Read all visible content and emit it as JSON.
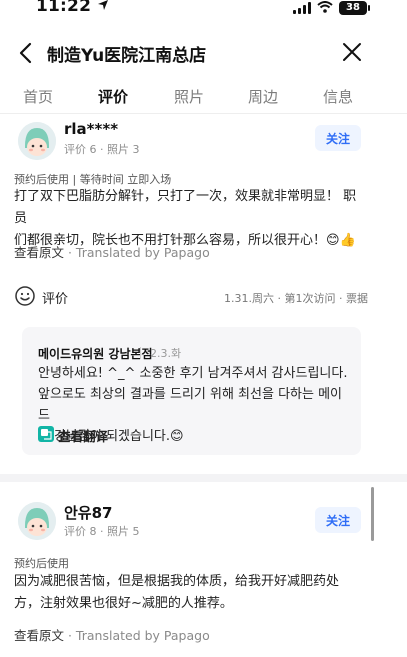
{
  "status_bar": {
    "time": "11:22",
    "battery": "38"
  },
  "header": {
    "title": "制造Yu医院江南总店"
  },
  "tabs": [
    {
      "label": "首页",
      "active": false
    },
    {
      "label": "评价",
      "active": true
    },
    {
      "label": "照片",
      "active": false
    },
    {
      "label": "周边",
      "active": false
    },
    {
      "label": "信息",
      "active": false
    }
  ],
  "reviews": [
    {
      "username": "rla****",
      "meta": "评价 6 · 照片 3",
      "follow_label": "关注",
      "tags": "预约后使用 | 等待时间 立即入场",
      "body_line1": "打了双下巴脂肪分解针，只打了一次，效果就非常明显！ 职员",
      "body_line2": "们都很亲切，院长也不用打针那么容易，所以很开心！😊👍",
      "translate_main": "查看原文",
      "translate_sub": " · Translated by Papago",
      "rating_label": "评价",
      "visit_info": "1.31.周六 · 第1次访问 · 票据",
      "reply": {
        "name": "메이드유의원 강남본점",
        "date": "2.3.화",
        "line1": "안녕하세요! ^_^ 소중한 후기 남겨주셔서 감사드립니다.",
        "line2": "앞으로도 최상의 결과를 드리기 위해 최선을 다하는 메이드",
        "line3": "유 강남점이 되겠습니다.😊",
        "translate_label": "查看翻译"
      }
    },
    {
      "username": "안유87",
      "meta": "评价 8 · 照片 5",
      "follow_label": "关注",
      "tags": "预约后使用",
      "body_line1": "因为减肥很苦恼，但是根据我的体质，给我开好减肥药处",
      "body_line2": "方，注射效果也很好~减肥的人推荐。",
      "translate_main": "查看原文",
      "translate_sub": " · Translated by Papago"
    }
  ],
  "colors": {
    "accent": "#2f6df6",
    "follow_bg": "#eef4ff",
    "reply_bg": "#f6f6f8",
    "muted_text": "#8e8e8e"
  }
}
